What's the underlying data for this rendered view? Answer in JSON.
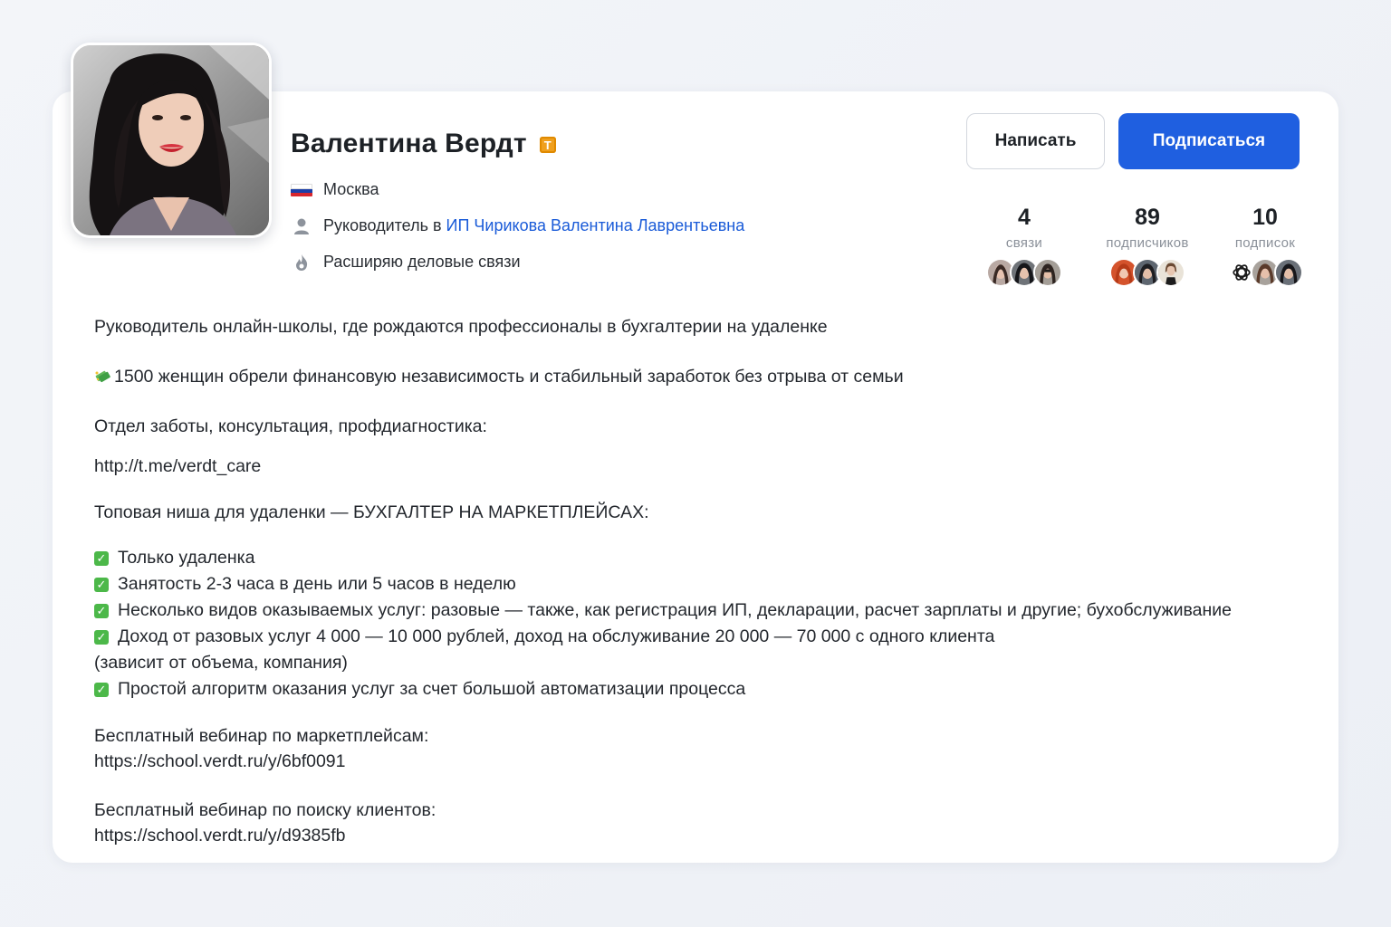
{
  "profile": {
    "name": "Валентина Вердт",
    "badge": "T",
    "city": "Москва",
    "role_prefix": "Руководитель в",
    "company": "ИП Чирикова Валентина Лаврентьевна",
    "goal": "Расширяю деловые связи"
  },
  "actions": {
    "write_label": "Написать",
    "subscribe_label": "Подписаться"
  },
  "stats": [
    {
      "value": "4",
      "label": "связи"
    },
    {
      "value": "89",
      "label": "подписчиков"
    },
    {
      "value": "10",
      "label": "подписок"
    }
  ],
  "bio": {
    "line1": "Руководитель онлайн-школы, где рождаются профессионалы в бухгалтерии на удаленке",
    "line2": "1500 женщин обрели финансовую независимость и стабильный заработок без отрыва от семьи",
    "line3": "Отдел заботы, консультация, профдиагностика:",
    "line4": "http://t.me/verdt_care",
    "line5": "Топовая ниша для удаленки — БУХГАЛТЕР НА МАРКЕТПЛЕЙСАХ:",
    "bullets": [
      "Только удаленка",
      "Занятость 2-3 часа в день или 5 часов в неделю",
      "Несколько видов оказываемых услуг: разовые — также, как регистрация ИП, декларации, расчет зарплаты и другие; бухобслуживание",
      "Доход от разовых услуг 4 000 — 10 000 рублей, доход на обслуживание 20 000 — 70 000 с одного клиента",
      "Простой алгоритм оказания услуг за счет большой автоматизации процесса"
    ],
    "bullet4_cont": "(зависит от объема, компания)",
    "webinar1_title": "Бесплатный вебинар по маркетплейсам:",
    "webinar1_link": "https://school.verdt.ru/y/6bf0091",
    "webinar2_title": "Бесплатный вебинар по поиску клиентов:",
    "webinar2_link": "https://school.verdt.ru/y/d9385fb"
  },
  "colors": {
    "accent": "#1f5fe0",
    "link": "#1a5bd8",
    "badge": "#f0a01e",
    "check": "#4cb849"
  }
}
